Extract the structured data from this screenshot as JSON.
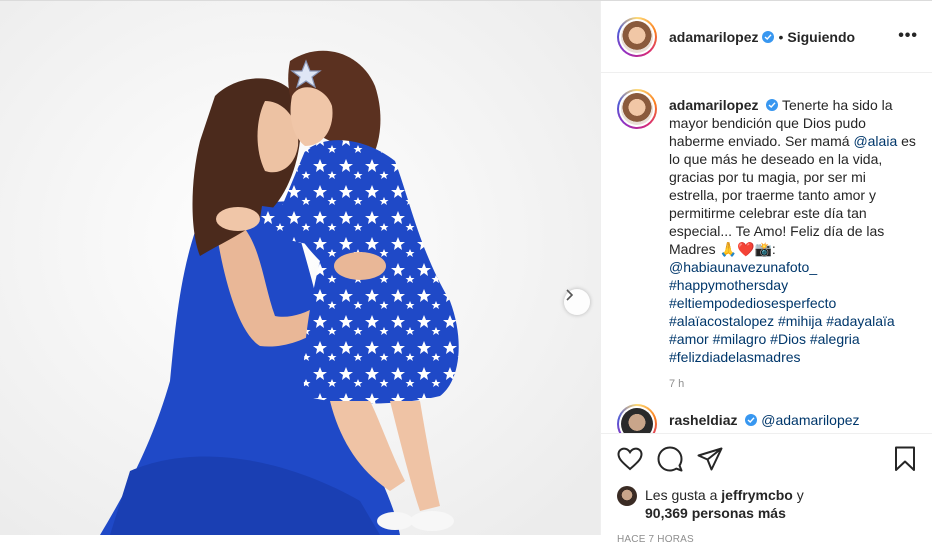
{
  "post": {
    "author": "adamarilopez",
    "follow_status": "Siguiendo",
    "separator": "•",
    "more_label": "•••",
    "caption_pre": "Tenerte ha sido la mayor bendición que Dios pudo haberme enviado. Ser mamá ",
    "caption_mention": "@alaia",
    "caption_post": " es lo que más he deseado en la vida, gracias por tu magia, por ser mi estrella, por traerme tanto amor y permitirme celebrar este día tan especial... Te Amo! Feliz día de las Madres ",
    "caption_emoji": "🙏❤️📸:",
    "tags": [
      "@habiaunavezunafoto_",
      "#happymothersday",
      "#eltiempodediosesperfecto",
      "#alaïacostalopez",
      "#mihija",
      "#adayalaïa",
      "#amor",
      "#milagro",
      "#Dios",
      "#alegria",
      "#felizdiadelasmadres"
    ],
    "caption_time": "7 h",
    "comment": {
      "author": "rasheldiaz",
      "text": "@adamarilopez"
    },
    "likes": {
      "prefix": "Les gusta a",
      "user": "jeffrymcbo",
      "mid": "y",
      "count": "90,369 personas más"
    },
    "posted_ago": "HACE 7 HORAS"
  },
  "icons": {
    "like": "heart-icon",
    "comment": "comment-icon",
    "share": "send-icon",
    "save": "bookmark-icon",
    "next": "chevron-right-icon",
    "verified": "verified-badge-icon"
  },
  "colors": {
    "link": "#00376b",
    "verified": "#3897f0",
    "dress": "#1f49c7"
  }
}
